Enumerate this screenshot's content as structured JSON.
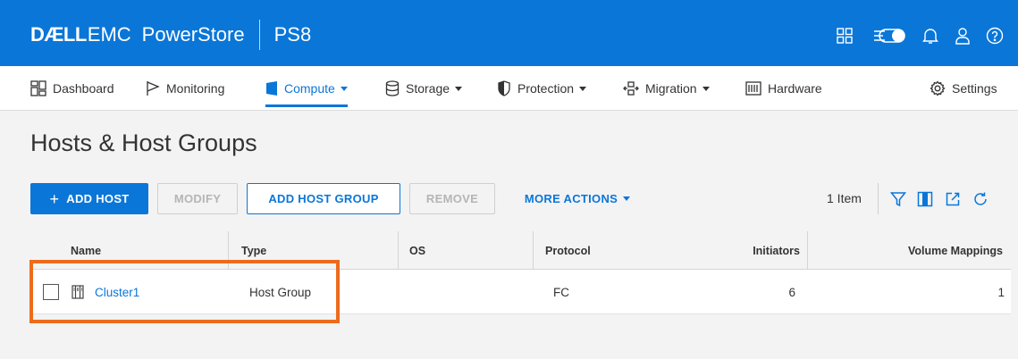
{
  "header": {
    "brand_dell": "DÆLL",
    "brand_emc": "EMC",
    "product": "PowerStore",
    "system_name": "PS8",
    "icons": [
      "grid-icon",
      "toggle-icon",
      "bell-icon",
      "user-icon",
      "help-icon"
    ]
  },
  "nav": {
    "items": [
      {
        "label": "Dashboard",
        "icon": "dashboard-icon",
        "has_caret": false
      },
      {
        "label": "Monitoring",
        "icon": "flag-icon",
        "has_caret": false
      },
      {
        "label": "Compute",
        "icon": "compute-icon",
        "has_caret": true,
        "active": true
      },
      {
        "label": "Storage",
        "icon": "storage-icon",
        "has_caret": true
      },
      {
        "label": "Protection",
        "icon": "shield-icon",
        "has_caret": true
      },
      {
        "label": "Migration",
        "icon": "migration-icon",
        "has_caret": true
      },
      {
        "label": "Hardware",
        "icon": "hardware-icon",
        "has_caret": false
      }
    ],
    "settings_label": "Settings"
  },
  "page": {
    "title": "Hosts & Host Groups"
  },
  "toolbar": {
    "add_host_label": "ADD HOST",
    "modify_label": "MODIFY",
    "add_host_group_label": "ADD HOST GROUP",
    "remove_label": "REMOVE",
    "more_actions_label": "MORE ACTIONS",
    "item_count": "1 Item"
  },
  "table": {
    "columns": [
      "Name",
      "Type",
      "OS",
      "Protocol",
      "Initiators",
      "Volume Mappings"
    ],
    "rows": [
      {
        "name": "Cluster1",
        "type": "Host Group",
        "os": "",
        "protocol": "FC",
        "initiators": "6",
        "volume_mappings": "1"
      }
    ]
  },
  "colors": {
    "brand_blue": "#0a76d8",
    "highlight_orange": "#ec6c1c"
  }
}
